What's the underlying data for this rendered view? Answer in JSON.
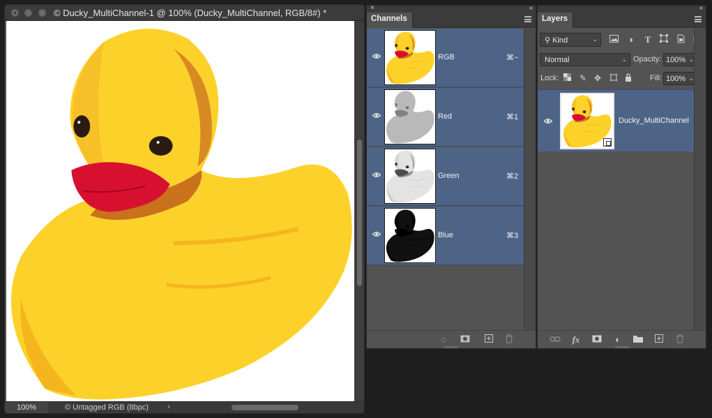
{
  "document": {
    "title": "© Ducky_MultiChannel-1 @ 100% (Ducky_MultiChannel, RGB/8#) *",
    "zoom": "100%",
    "profile": "© Untagged RGB (8bpc)",
    "status_arrow": "›"
  },
  "channels_panel": {
    "tab": "Channels",
    "close_glyph": "×",
    "collapse_glyph": "«",
    "channels": [
      {
        "name": "RGB",
        "shortcut": "⌘~"
      },
      {
        "name": "Red",
        "shortcut": "⌘1"
      },
      {
        "name": "Green",
        "shortcut": "⌘2"
      },
      {
        "name": "Blue",
        "shortcut": "⌘3"
      }
    ],
    "footer_icons": [
      "load-selection-icon",
      "save-selection-icon",
      "new-channel-icon",
      "delete-channel-icon"
    ]
  },
  "layers_panel": {
    "tab": "Layers",
    "collapse_glyph": "«",
    "filter_kind": "Kind",
    "filter_icons": [
      "pixel-filter-icon",
      "adjustment-filter-icon",
      "type-filter-icon",
      "shape-filter-icon",
      "smart-object-filter-icon"
    ],
    "blend_mode": "Normal",
    "opacity_label": "Opacity:",
    "opacity_value": "100%",
    "lock_label": "Lock:",
    "fill_label": "Fill:",
    "fill_value": "100%",
    "layers": [
      {
        "name": "Ducky_MultiChannel"
      }
    ],
    "footer_icons": [
      "link-layers-icon",
      "fx-icon",
      "add-mask-icon",
      "adjustment-layer-icon",
      "new-group-icon",
      "new-layer-icon",
      "delete-layer-icon"
    ]
  },
  "colors": {
    "accent_selection": "#4e6486",
    "panel_bg": "#535353",
    "duck_yellow": "#fcd22a",
    "duck_orange": "#c9711d",
    "beak_red": "#d8102f"
  }
}
